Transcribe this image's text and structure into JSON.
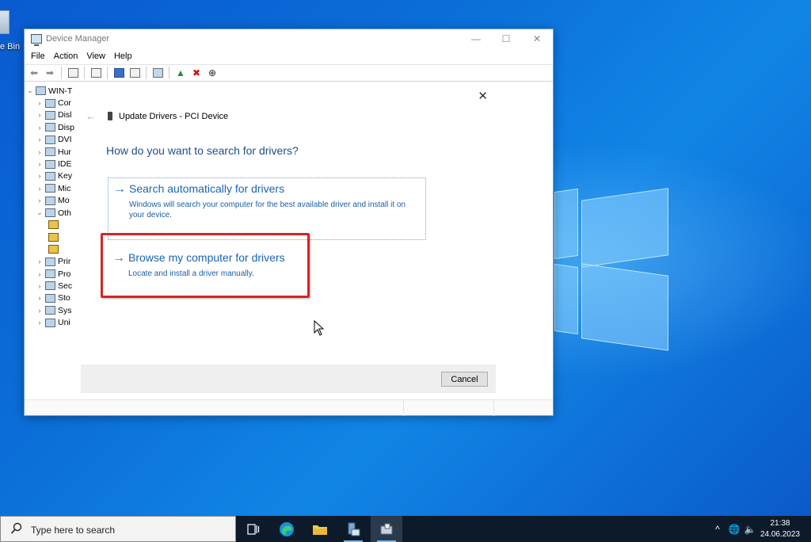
{
  "desktop": {
    "recycle_bin_label": "e Bin"
  },
  "window": {
    "title": "Device Manager",
    "controls": {
      "minimize": "—",
      "maximize": "☐",
      "close": "✕"
    }
  },
  "menu": [
    "File",
    "Action",
    "View",
    "Help"
  ],
  "tree": {
    "root": "WIN-T",
    "items": [
      {
        "label": "Cor",
        "chevron": "›",
        "warn": false
      },
      {
        "label": "Disl",
        "chevron": "›",
        "warn": false
      },
      {
        "label": "Disp",
        "chevron": "›",
        "warn": false
      },
      {
        "label": "DVI",
        "chevron": "›",
        "warn": false
      },
      {
        "label": "Hur",
        "chevron": "›",
        "warn": false
      },
      {
        "label": "IDE",
        "chevron": "›",
        "warn": false
      },
      {
        "label": "Key",
        "chevron": "›",
        "warn": false
      },
      {
        "label": "Mic",
        "chevron": "›",
        "warn": false
      },
      {
        "label": "Mo",
        "chevron": "›",
        "warn": false
      },
      {
        "label": "Oth",
        "chevron": "⌄",
        "warn": false
      },
      {
        "label": "",
        "chevron": "",
        "warn": true
      },
      {
        "label": "",
        "chevron": "",
        "warn": true
      },
      {
        "label": "",
        "chevron": "",
        "warn": true
      },
      {
        "label": "Prir",
        "chevron": "›",
        "warn": false
      },
      {
        "label": "Pro",
        "chevron": "›",
        "warn": false
      },
      {
        "label": "Sec",
        "chevron": "›",
        "warn": false
      },
      {
        "label": "Sto",
        "chevron": "›",
        "warn": false
      },
      {
        "label": "Sys",
        "chevron": "›",
        "warn": false
      },
      {
        "label": "Uni",
        "chevron": "›",
        "warn": false
      }
    ]
  },
  "dialog": {
    "title": "Update Drivers - PCI Device",
    "question": "How do you want to search for drivers?",
    "option_auto": {
      "title": "Search automatically for drivers",
      "description": "Windows will search your computer for the best available driver and install it on your device."
    },
    "option_browse": {
      "title": "Browse my computer for drivers",
      "description": "Locate and install a driver manually."
    },
    "cancel_label": "Cancel",
    "close_glyph": "✕",
    "back_glyph": "←",
    "arrow_glyph": "→"
  },
  "taskbar": {
    "search_placeholder": "Type here to search",
    "apps": [
      "task-view",
      "edge",
      "file-explorer",
      "server-manager",
      "device-manager"
    ],
    "tray": {
      "chevron": "^",
      "network": "🌐",
      "volume": "🔈"
    },
    "time": "21:38",
    "date": "24.06.2023"
  },
  "colors": {
    "accent_link": "#1a64b8",
    "question_blue": "#1f4e8f",
    "highlight_red": "#d62525",
    "taskbar": "#0d1a2a"
  }
}
